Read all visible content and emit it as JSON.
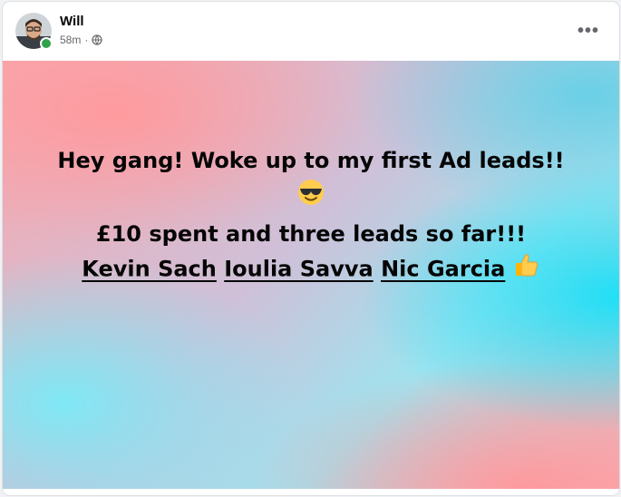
{
  "post": {
    "author_name": "Will",
    "timestamp": "58m",
    "separator": "·",
    "privacy_icon": "globe-icon",
    "more_label": "•••",
    "text_line_1": "Hey gang! Woke up to my first Ad leads!!",
    "emoji_1": "smiling-face-with-sunglasses-emoji",
    "text_line_3": "£10 spent and three leads so far!!!",
    "mentions": [
      "Kevin Sach",
      "Ioulia Savva",
      "Nic Garcia"
    ],
    "emoji_2": "thumbs-up-emoji"
  },
  "colors": {
    "presence_online": "#31a24c",
    "text_primary": "#050505",
    "text_secondary": "#65676b",
    "bg_pink": "#ff9a9e",
    "bg_cyan": "#1fe0f7"
  }
}
